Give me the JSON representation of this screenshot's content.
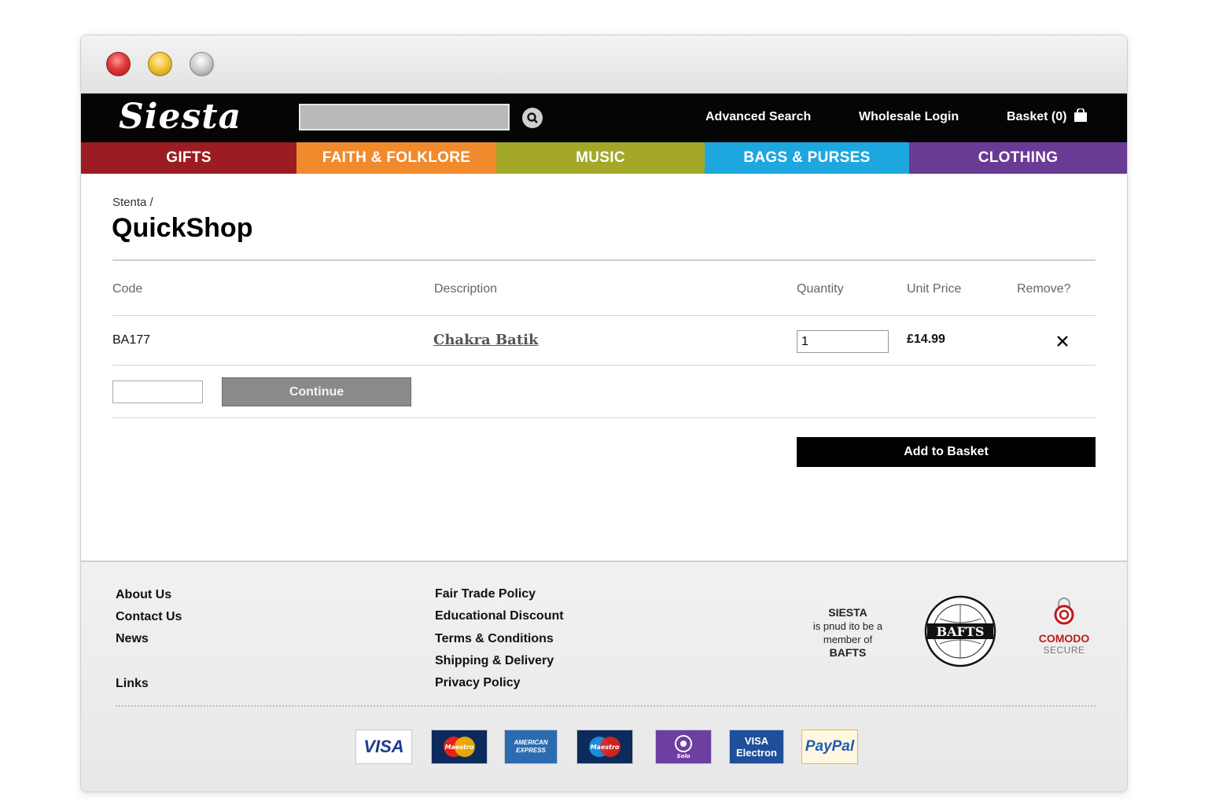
{
  "header": {
    "logo": "Siesta",
    "links": {
      "advanced_search": "Advanced Search",
      "wholesale_login": "Wholesale Login",
      "basket": "Basket (0)"
    }
  },
  "nav": {
    "items": [
      {
        "label": "GIFTS",
        "color": "#9b1c22"
      },
      {
        "label": "FAITH & FOLKLORE",
        "color": "#f08a2c"
      },
      {
        "label": "MUSIC",
        "color": "#a3a829"
      },
      {
        "label": "BAGS & PURSES",
        "color": "#1ea7df"
      },
      {
        "label": "CLOTHING",
        "color": "#6a3b95"
      }
    ]
  },
  "page": {
    "breadcrumb": "Stenta /",
    "title": "QuickShop"
  },
  "table": {
    "headers": {
      "code": "Code",
      "description": "Description",
      "quantity": "Quantity",
      "unit_price": "Unit Price",
      "remove": "Remove?"
    },
    "rows": [
      {
        "code": "BA177",
        "description": "Chakra Batik",
        "quantity": "1",
        "unit_price": "£14.99"
      }
    ]
  },
  "actions": {
    "continue": "Continue",
    "add_to_basket": "Add to Basket"
  },
  "footer": {
    "col1": [
      "About Us",
      "Contact Us",
      "News",
      "Links"
    ],
    "col2": [
      "Fair Trade Policy",
      "Educational Discount",
      "Terms & Conditions",
      "Shipping & Delivery",
      "Privacy Policy"
    ],
    "bafts": {
      "line1": "SIESTA",
      "line2": "is pnud ito be a",
      "line3": "member of",
      "line4": "BAFTS",
      "logo_text": "BAFTS"
    },
    "comodo": {
      "brand": "COMODO",
      "sub": "SECURE"
    },
    "payment_cards": [
      "VISA",
      "Maestro",
      "AMERICAN EXPRESS",
      "Maestro",
      "Solo",
      "VISA Electron",
      "PayPal"
    ]
  }
}
